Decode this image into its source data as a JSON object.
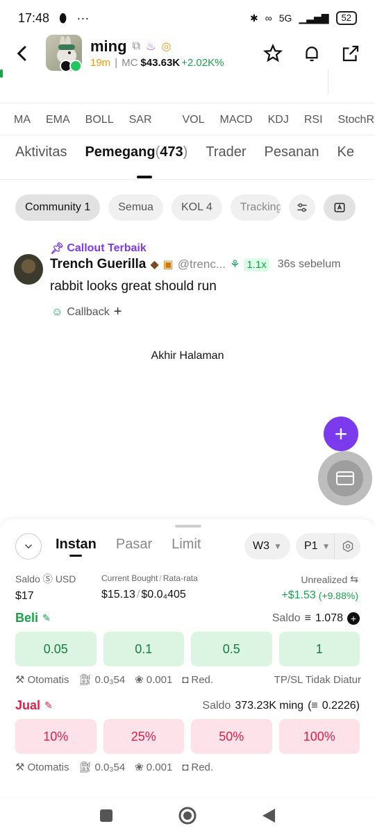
{
  "status_bar": {
    "time": "17:48",
    "network": "5G",
    "battery": "52"
  },
  "token": {
    "name": "ming",
    "age": "19m",
    "mc_label": "MC",
    "mc_value": "$43.63K",
    "mc_change": "+2.02K%"
  },
  "indicators": [
    "MA",
    "EMA",
    "BOLL",
    "SAR",
    "VOL",
    "MACD",
    "KDJ",
    "RSI",
    "StochRsi"
  ],
  "tabs": {
    "aktivitas": "Aktivitas",
    "pemegang": "Pemegang",
    "pemegang_count": "473",
    "trader": "Trader",
    "pesanan": "Pesanan",
    "more": "Ke"
  },
  "chips": {
    "community": "Community 1",
    "semua": "Semua",
    "kol": "KOL 4",
    "tracking": "Tracking"
  },
  "callout": {
    "label": "Callout Terbaik",
    "user": "Trench Guerilla",
    "handle": "@trenc...",
    "multiplier": "1.1x",
    "time_ago": "36s sebelum",
    "message": "rabbit looks great should run",
    "callback": "Callback"
  },
  "end_of_page": "Akhir Halaman",
  "panel": {
    "tabs": {
      "instan": "Instan",
      "pasar": "Pasar",
      "limit": "Limit"
    },
    "wallet": "W3",
    "preset": "P1",
    "saldo_label": "Saldo",
    "saldo_unit": "USD",
    "saldo_value": "$17",
    "bought_label": "Current Bought",
    "avg_label": "Rata-rata",
    "bought_value": "$15.13",
    "avg_value": "$0.0₄405",
    "unrealized_label": "Unrealized",
    "unrealized_value": "+$1.53",
    "unrealized_pct": "(+9.88%)",
    "buy": {
      "label": "Beli",
      "balance_label": "Saldo",
      "balance_value": "1.078",
      "amounts": [
        "0.05",
        "0.1",
        "0.5",
        "1"
      ]
    },
    "sell": {
      "label": "Jual",
      "balance_label": "Saldo",
      "balance_value": "373.23K ming",
      "balance_sol": "0.2226",
      "percents": [
        "10%",
        "25%",
        "50%",
        "100%"
      ]
    },
    "meta": {
      "auto": "Otomatis",
      "gas": "0.0₃54",
      "tip": "0.001",
      "red": "Red.",
      "tpsl": "TP/SL Tidak Diatur"
    }
  }
}
